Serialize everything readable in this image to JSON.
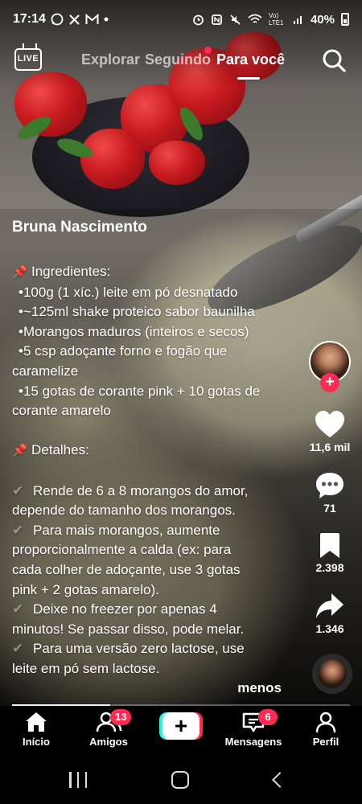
{
  "status_bar": {
    "time": "17:14",
    "app_icons": [
      "whatsapp-icon",
      "x-icon",
      "gmail-icon",
      "dot-icon"
    ],
    "battery_percent": "40%",
    "network": "Vo) LTE1"
  },
  "top_nav": {
    "live_label": "LIVE",
    "tabs": [
      "Explorar",
      "Seguindo",
      "Para você"
    ],
    "active_tab": "Para você"
  },
  "post": {
    "author": "Bruna Nascimento",
    "caption_lines": [
      {
        "type": "heading",
        "icon": "pin-icon",
        "text": "Ingredientes:"
      },
      {
        "type": "bullet",
        "text": "•100g (1 xíc.) leite em pó desnatado"
      },
      {
        "type": "bullet",
        "text": "•~125ml shake proteico sabor baunilha"
      },
      {
        "type": "bullet",
        "text": "•Morangos maduros (inteiros e secos)"
      },
      {
        "type": "bullet",
        "text": "•5 csp adoçante forno e fogão que"
      },
      {
        "type": "cont",
        "text": "caramelize"
      },
      {
        "type": "bullet",
        "text": "•15 gotas de corante pink + 10 gotas de"
      },
      {
        "type": "cont",
        "text": "corante amarelo"
      },
      {
        "type": "gap",
        "text": ""
      },
      {
        "type": "heading",
        "icon": "pin-icon",
        "text": "Detalhes:"
      },
      {
        "type": "gap",
        "text": ""
      },
      {
        "type": "check",
        "icon": "check-icon",
        "text": "Rende de 6 a 8 morangos do amor,"
      },
      {
        "type": "cont",
        "text": "depende do tamanho dos morangos."
      },
      {
        "type": "check",
        "icon": "check-icon",
        "text": "Para mais morangos, aumente"
      },
      {
        "type": "cont",
        "text": "proporcionalmente a calda (ex: para"
      },
      {
        "type": "cont",
        "text": "cada colher de adoçante, use 3 gotas"
      },
      {
        "type": "cont",
        "text": "pink + 2 gotas amarelo)."
      },
      {
        "type": "check",
        "icon": "check-icon",
        "text": "Deixe no freezer por apenas 4"
      },
      {
        "type": "cont",
        "text": "minutos! Se passar disso, pode melar."
      },
      {
        "type": "check",
        "icon": "check-icon",
        "text": "Para uma versão zero lactose, use"
      },
      {
        "type": "cont",
        "text": "leite em pó sem lactose."
      }
    ],
    "collapse_label": "menos",
    "progress_fraction": 0.29
  },
  "actions": {
    "likes": "11,6 mil",
    "comments": "71",
    "saves": "2.398",
    "shares": "1.346",
    "follow_symbol": "+"
  },
  "bottom_nav": {
    "home": "Início",
    "friends": "Amigos",
    "friends_badge": "13",
    "create_symbol": "+",
    "messages": "Mensagens",
    "messages_badge": "6",
    "profile": "Perfil"
  },
  "colors": {
    "accent": "#fe2c55",
    "cyan": "#25f4ee"
  }
}
